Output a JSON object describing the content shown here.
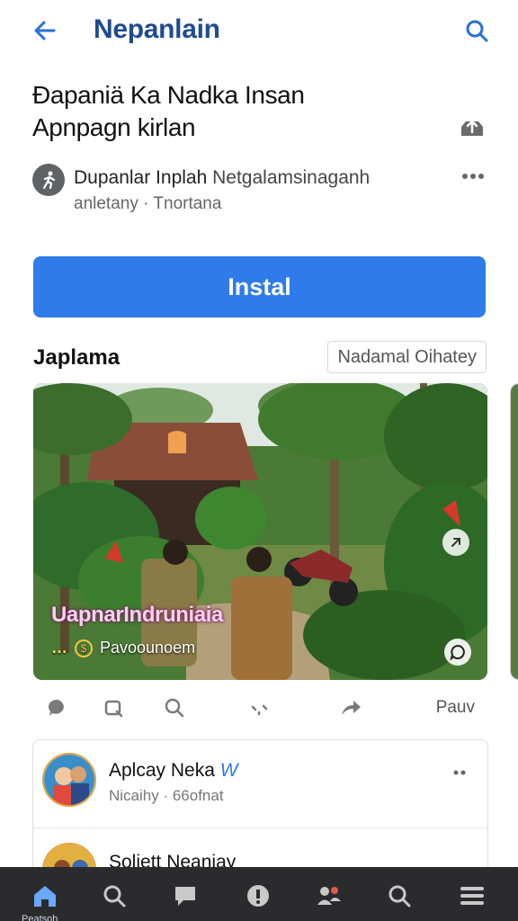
{
  "header": {
    "title": "Nepanlain",
    "back_icon": "arrow-left-icon",
    "search_icon": "search-icon"
  },
  "app": {
    "title_line1": "Ðapaniä Ka Nadka Insan",
    "title_line2": "Apnpagn kirlan",
    "developer_name": "Dupanlar Inplah",
    "developer_name_extra": "Netgalamsinaganh",
    "developer_sub_left": "anletany",
    "developer_sub_sep": "·",
    "developer_sub_right": "Tnortana"
  },
  "install": {
    "label": "Instal"
  },
  "section": {
    "title": "Japlama",
    "chip_label": "Nadamal Oihatey"
  },
  "media": {
    "caption": "UapnarIndruniaia",
    "tag": "…",
    "meta_text": "Pavoounoem"
  },
  "actions": {
    "right_label": "Pauv"
  },
  "comments": [
    {
      "name": "Aplcay Neka",
      "verified_mark": "W",
      "sub": "Nicaihy · 66ofnat"
    },
    {
      "name": "Soliett Neaniay",
      "verified_mark": "",
      "sub": ""
    }
  ],
  "nav": {
    "items": [
      {
        "icon": "home-icon",
        "label": "Peatsoh"
      },
      {
        "icon": "search-icon",
        "label": ""
      },
      {
        "icon": "chat-icon",
        "label": ""
      },
      {
        "icon": "info-icon",
        "label": ""
      },
      {
        "icon": "people-icon",
        "label": ""
      },
      {
        "icon": "search-icon",
        "label": ""
      },
      {
        "icon": "menu-icon",
        "label": ""
      }
    ]
  },
  "colors": {
    "accent": "#2f7bea",
    "header_title": "#1f4b8f",
    "nav_bg": "#2b2b2d"
  }
}
